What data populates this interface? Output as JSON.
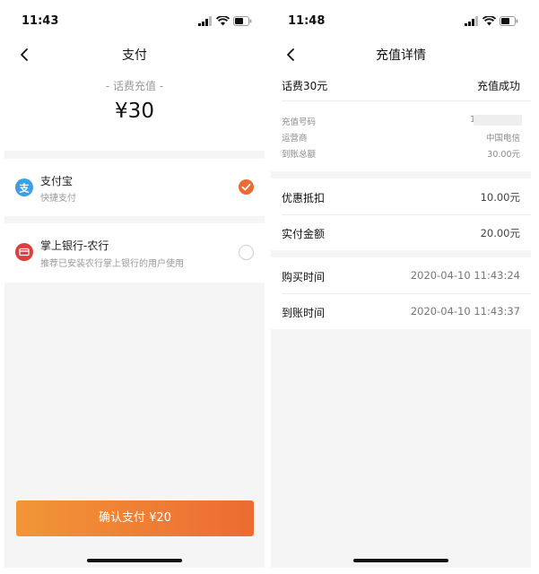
{
  "left": {
    "status_time": "11:43",
    "nav_title": "支付",
    "subtitle": "- 话费充值 -",
    "amount": "¥30",
    "options": [
      {
        "name": "支付宝",
        "desc": "快捷支付",
        "icon": "alipay-icon",
        "selected": true
      },
      {
        "name": "掌上银行-农行",
        "desc": "推荐已安装农行掌上银行的用户使用",
        "icon": "bank-card-icon",
        "selected": false
      }
    ],
    "confirm_label": "确认支付 ¥20"
  },
  "right": {
    "status_time": "11:48",
    "nav_title": "充值详情",
    "product": "话费30元",
    "status": "充值成功",
    "details": [
      {
        "label": "充值号码",
        "value": "1"
      },
      {
        "label": "运营商",
        "value": "中国电信"
      },
      {
        "label": "到账总额",
        "value": "30.00元"
      }
    ],
    "discount": {
      "label": "优惠抵扣",
      "value": "10.00元"
    },
    "paid": {
      "label": "实付金额",
      "value": "20.00元"
    },
    "purchase_time": {
      "label": "购买时间",
      "value": "2020-04-10 11:43:24"
    },
    "arrival_time": {
      "label": "到账时间",
      "value": "2020-04-10 11:43:37"
    }
  },
  "colors": {
    "accent_orange": "#ec6b32",
    "alipay_blue": "#3da0e6",
    "bank_red": "#d9413a"
  }
}
